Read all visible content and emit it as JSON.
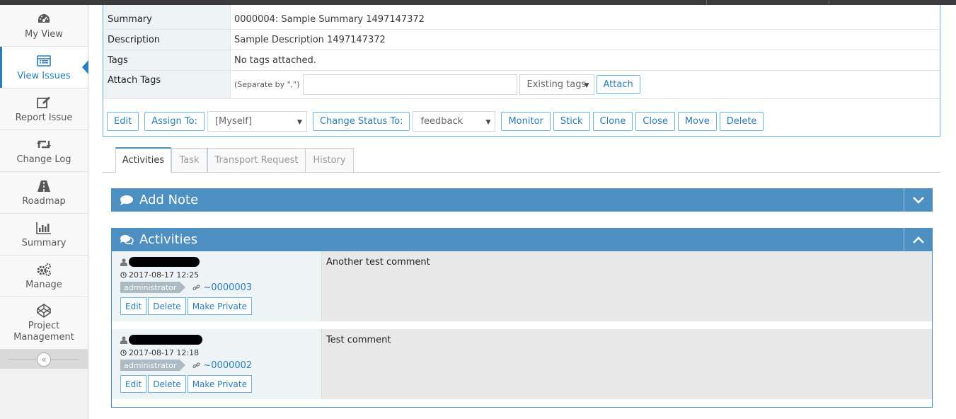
{
  "sidebar": {
    "items": [
      {
        "label": "My View",
        "icon": "dashboard-icon"
      },
      {
        "label": "View Issues",
        "icon": "list-icon",
        "active": true
      },
      {
        "label": "Report Issue",
        "icon": "edit-icon"
      },
      {
        "label": "Change Log",
        "icon": "retweet-icon"
      },
      {
        "label": "Roadmap",
        "icon": "road-icon"
      },
      {
        "label": "Summary",
        "icon": "bar-chart-icon"
      },
      {
        "label": "Manage",
        "icon": "gears-icon"
      },
      {
        "label": "Project Management",
        "icon": "codepen-icon"
      }
    ],
    "collapse_glyph": "«"
  },
  "details": {
    "summary_label": "Summary",
    "summary_value": "0000004: Sample Summary 1497147372",
    "description_label": "Description",
    "description_value": "Sample Description 1497147372",
    "tags_label": "Tags",
    "tags_value": "No tags attached.",
    "attach_tags_label": "Attach Tags",
    "attach_hint": "(Separate by \",\")",
    "existing_tags": "Existing tags",
    "attach_button": "Attach"
  },
  "actions": {
    "edit": "Edit",
    "assign_to": "Assign To:",
    "assign_value": "[Myself]",
    "change_status": "Change Status To:",
    "status_value": "feedback",
    "monitor": "Monitor",
    "stick": "Stick",
    "clone": "Clone",
    "close": "Close",
    "move": "Move",
    "delete": "Delete"
  },
  "tabs": [
    "Activities",
    "Task",
    "Transport Request",
    "History"
  ],
  "add_note": {
    "title": "Add Note"
  },
  "activities": {
    "title": "Activities",
    "notes": [
      {
        "timestamp": "2017-08-17 12:25",
        "role": "administrator",
        "note_id": "~0000003",
        "text": "Another test comment",
        "buttons": [
          "Edit",
          "Delete",
          "Make Private"
        ]
      },
      {
        "timestamp": "2017-08-17 12:18",
        "role": "administrator",
        "note_id": "~0000002",
        "text": "Test comment",
        "buttons": [
          "Edit",
          "Delete",
          "Make Private"
        ]
      }
    ]
  },
  "colors": {
    "accent": "#2b7dbc",
    "widget_header": "#4e8fc2",
    "badge": "#abbac3"
  }
}
